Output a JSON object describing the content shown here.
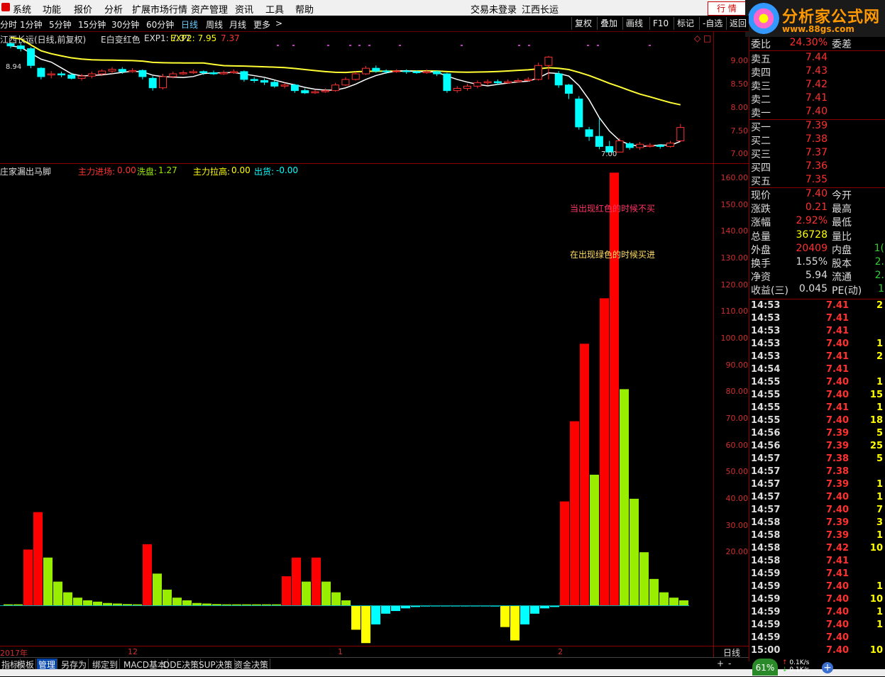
{
  "menubar": {
    "items": [
      "系统",
      "功能",
      "报价",
      "分析",
      "扩展市场行情",
      "资产管理",
      "资讯",
      "工具",
      "帮助"
    ],
    "trade_status": "交易未登录",
    "stock_name": "江西长运",
    "trade_button": "行  情"
  },
  "brand": {
    "title": "分析家公式网",
    "url": "www.88gs.com"
  },
  "timeframes": {
    "items": [
      "分时",
      "1分钟",
      "5分钟",
      "15分钟",
      "30分钟",
      "60分钟",
      "日线",
      "周线",
      "月线",
      "更多"
    ],
    "active": "日线",
    "more_arrow": ">"
  },
  "chart_toolbar": [
    "复权",
    "叠加",
    "画线",
    "F10",
    "标记",
    "-自选",
    "返回"
  ],
  "price_panel": {
    "title": "江西长运(日线,前复权)",
    "indicator_name": "E白变红色",
    "exp1_label": "EXP1: 7.37",
    "exp2_label": "EXP2: 7.95",
    "last_value": "7.37",
    "high_marker": "8.94",
    "low_marker": "7.00",
    "axis_ticks": [
      "9.00",
      "8.50",
      "8.00",
      "7.50",
      "7.00"
    ],
    "icons": [
      "diamond-icon",
      "square-icon"
    ]
  },
  "volume_panel": {
    "title": "庄家漏出马脚",
    "lbl_main_entry": "主力进场:",
    "val_main_entry": "0.00",
    "lbl_wash": "洗盘:",
    "val_wash": "1.27",
    "lbl_pull": "主力拉高:",
    "val_pull": "0.00",
    "lbl_out": "出货:",
    "val_out": "-0.00",
    "note_red": "当出现红色的时候不买",
    "note_green": "在出现绿色的时候买进",
    "axis_ticks": [
      "160.00",
      "150.00",
      "140.00",
      "130.00",
      "120.00",
      "110.00",
      "100.00",
      "90.00",
      "80.00",
      "70.00",
      "60.00",
      "50.00",
      "40.00",
      "30.00",
      "20.00"
    ]
  },
  "chart_data": {
    "type": "bar",
    "ylim": [
      -15,
      165
    ],
    "colors": {
      "main": "#ff0000",
      "wash": "#99ee00",
      "pull": "#ffff00",
      "out": "#00ffff"
    },
    "bars": [
      {
        "type": "wash",
        "value": 0.5
      },
      {
        "type": "wash",
        "value": 0.5
      },
      {
        "type": "main",
        "value": 21
      },
      {
        "type": "main",
        "value": 35
      },
      {
        "type": "wash",
        "value": 18
      },
      {
        "type": "wash",
        "value": 9
      },
      {
        "type": "wash",
        "value": 5
      },
      {
        "type": "wash",
        "value": 3
      },
      {
        "type": "wash",
        "value": 2
      },
      {
        "type": "wash",
        "value": 1.5
      },
      {
        "type": "wash",
        "value": 1
      },
      {
        "type": "wash",
        "value": 0.8
      },
      {
        "type": "wash",
        "value": 0.6
      },
      {
        "type": "wash",
        "value": 0.5
      },
      {
        "type": "main",
        "value": 23
      },
      {
        "type": "wash",
        "value": 12
      },
      {
        "type": "wash",
        "value": 6
      },
      {
        "type": "wash",
        "value": 3
      },
      {
        "type": "wash",
        "value": 2
      },
      {
        "type": "wash",
        "value": 1
      },
      {
        "type": "wash",
        "value": 0.8
      },
      {
        "type": "wash",
        "value": 0.6
      },
      {
        "type": "wash",
        "value": 0.5
      },
      {
        "type": "wash",
        "value": 0.5
      },
      {
        "type": "wash",
        "value": 0.5
      },
      {
        "type": "wash",
        "value": 0.5
      },
      {
        "type": "wash",
        "value": 0.5
      },
      {
        "type": "wash",
        "value": 0.5
      },
      {
        "type": "main",
        "value": 11
      },
      {
        "type": "main",
        "value": 18
      },
      {
        "type": "wash",
        "value": 9
      },
      {
        "type": "main",
        "value": 18
      },
      {
        "type": "wash",
        "value": 9
      },
      {
        "type": "wash",
        "value": 5
      },
      {
        "type": "wash",
        "value": 2
      },
      {
        "type": "pull",
        "value": -9
      },
      {
        "type": "pull",
        "value": -14
      },
      {
        "type": "out",
        "value": -7
      },
      {
        "type": "out",
        "value": -3
      },
      {
        "type": "out",
        "value": -2
      },
      {
        "type": "out",
        "value": -1
      },
      {
        "type": "out",
        "value": -0.5
      },
      {
        "type": "out",
        "value": -0.3
      },
      {
        "type": "out",
        "value": -0.2
      },
      {
        "type": "out",
        "value": -0.2
      },
      {
        "type": "out",
        "value": -0.2
      },
      {
        "type": "out",
        "value": -0.2
      },
      {
        "type": "out",
        "value": -0.2
      },
      {
        "type": "out",
        "value": -0.2
      },
      {
        "type": "out",
        "value": -0.3
      },
      {
        "type": "pull",
        "value": -8
      },
      {
        "type": "pull",
        "value": -13
      },
      {
        "type": "out",
        "value": -7
      },
      {
        "type": "out",
        "value": -3
      },
      {
        "type": "out",
        "value": -1
      },
      {
        "type": "out",
        "value": -0.5
      },
      {
        "type": "main",
        "value": 39
      },
      {
        "type": "main",
        "value": 69
      },
      {
        "type": "main",
        "value": 98
      },
      {
        "type": "wash",
        "value": 49
      },
      {
        "type": "main",
        "value": 115
      },
      {
        "type": "main",
        "value": 162
      },
      {
        "type": "wash",
        "value": 81
      },
      {
        "type": "wash",
        "value": 40
      },
      {
        "type": "wash",
        "value": 20
      },
      {
        "type": "wash",
        "value": 10
      },
      {
        "type": "wash",
        "value": 5
      },
      {
        "type": "wash",
        "value": 3
      },
      {
        "type": "wash",
        "value": 2
      }
    ]
  },
  "price_data": {
    "ylim": [
      6.8,
      9.15
    ],
    "candles": [
      [
        8.94,
        8.9,
        8.96,
        8.86
      ],
      [
        8.9,
        8.85,
        8.95,
        8.8
      ],
      [
        8.85,
        8.55,
        8.88,
        8.5
      ],
      [
        8.5,
        8.35,
        8.52,
        8.3
      ],
      [
        8.38,
        8.4,
        8.45,
        8.32
      ],
      [
        8.4,
        8.38,
        8.44,
        8.34
      ],
      [
        8.38,
        8.32,
        8.42,
        8.3
      ],
      [
        8.32,
        8.36,
        8.4,
        8.28
      ],
      [
        8.36,
        8.4,
        8.44,
        8.32
      ],
      [
        8.4,
        8.45,
        8.48,
        8.36
      ],
      [
        8.45,
        8.48,
        8.52,
        8.4
      ],
      [
        8.48,
        8.44,
        8.52,
        8.4
      ],
      [
        8.44,
        8.46,
        8.5,
        8.42
      ],
      [
        8.46,
        8.35,
        8.48,
        8.3
      ],
      [
        8.32,
        8.15,
        8.36,
        8.1
      ],
      [
        8.15,
        8.35,
        8.4,
        8.12
      ],
      [
        8.35,
        8.4,
        8.44,
        8.32
      ],
      [
        8.4,
        8.42,
        8.46,
        8.38
      ],
      [
        8.42,
        8.44,
        8.48,
        8.4
      ],
      [
        8.44,
        8.42,
        8.46,
        8.38
      ],
      [
        8.42,
        8.4,
        8.46,
        8.38
      ],
      [
        8.4,
        8.42,
        8.46,
        8.38
      ],
      [
        8.42,
        8.44,
        8.48,
        8.4
      ],
      [
        8.44,
        8.3,
        8.46,
        8.26
      ],
      [
        8.3,
        8.28,
        8.34,
        8.24
      ],
      [
        8.28,
        8.25,
        8.32,
        8.2
      ],
      [
        8.25,
        8.18,
        8.28,
        8.15
      ],
      [
        8.18,
        8.2,
        8.24,
        8.14
      ],
      [
        8.2,
        8.1,
        8.22,
        8.06
      ],
      [
        8.1,
        8.06,
        8.14,
        8.04
      ],
      [
        8.06,
        8.08,
        8.12,
        8.04
      ],
      [
        8.08,
        8.1,
        8.14,
        8.06
      ],
      [
        8.1,
        8.2,
        8.24,
        8.08
      ],
      [
        8.2,
        8.3,
        8.34,
        8.18
      ],
      [
        8.3,
        8.4,
        8.44,
        8.28
      ],
      [
        8.4,
        8.5,
        8.54,
        8.38
      ],
      [
        8.5,
        8.45,
        8.55,
        8.42
      ],
      [
        8.45,
        8.44,
        8.48,
        8.4
      ],
      [
        8.44,
        8.45,
        8.48,
        8.42
      ],
      [
        8.45,
        8.44,
        8.48,
        8.4
      ],
      [
        8.44,
        8.42,
        8.46,
        8.4
      ],
      [
        8.42,
        8.44,
        8.48,
        8.4
      ],
      [
        8.44,
        8.4,
        8.46,
        8.36
      ],
      [
        8.4,
        8.1,
        8.42,
        8.06
      ],
      [
        8.1,
        8.14,
        8.18,
        8.06
      ],
      [
        8.14,
        8.18,
        8.22,
        8.1
      ],
      [
        8.18,
        8.24,
        8.28,
        8.14
      ],
      [
        8.24,
        8.26,
        8.3,
        8.2
      ],
      [
        8.26,
        8.24,
        8.3,
        8.2
      ],
      [
        8.24,
        8.26,
        8.3,
        8.22
      ],
      [
        8.26,
        8.28,
        8.32,
        8.24
      ],
      [
        8.28,
        8.3,
        8.34,
        8.26
      ],
      [
        8.3,
        8.55,
        8.6,
        8.28
      ],
      [
        8.55,
        8.7,
        8.72,
        8.3
      ],
      [
        8.4,
        8.2,
        8.45,
        8.15
      ],
      [
        8.2,
        8.05,
        8.22,
        7.95
      ],
      [
        7.95,
        7.45,
        8.0,
        7.4
      ],
      [
        7.4,
        7.28,
        7.45,
        7.2
      ],
      [
        7.28,
        7.1,
        7.6,
        7.05
      ],
      [
        7.1,
        7.0,
        7.2,
        7.0
      ],
      [
        7.0,
        7.2,
        7.25,
        7.0
      ],
      [
        7.15,
        7.08,
        7.18,
        7.04
      ],
      [
        7.08,
        7.14,
        7.18,
        7.04
      ],
      [
        7.1,
        7.12,
        7.16,
        7.08
      ],
      [
        7.12,
        7.1,
        7.14,
        7.06
      ],
      [
        7.1,
        7.16,
        7.2,
        7.08
      ],
      [
        7.2,
        7.44,
        7.5,
        7.18
      ]
    ]
  },
  "quote": {
    "top_row": {
      "label": "委比",
      "value": "24.30%",
      "label2": "委差"
    },
    "asks": [
      {
        "label": "卖五",
        "price": "7.44"
      },
      {
        "label": "卖四",
        "price": "7.43"
      },
      {
        "label": "卖三",
        "price": "7.42"
      },
      {
        "label": "卖二",
        "price": "7.41"
      },
      {
        "label": "卖一",
        "price": "7.40"
      }
    ],
    "bids": [
      {
        "label": "买一",
        "price": "7.39"
      },
      {
        "label": "买二",
        "price": "7.38"
      },
      {
        "label": "买三",
        "price": "7.37"
      },
      {
        "label": "买四",
        "price": "7.36"
      },
      {
        "label": "买五",
        "price": "7.35"
      }
    ],
    "stats": [
      {
        "label": "现价",
        "value": "7.40",
        "vcolor": "#ff3030",
        "label2": "今开",
        "v2": ""
      },
      {
        "label": "涨跌",
        "value": "0.21",
        "vcolor": "#ff3030",
        "label2": "最高",
        "v2": ""
      },
      {
        "label": "涨幅",
        "value": "2.92%",
        "vcolor": "#ff3030",
        "label2": "最低",
        "v2": ""
      },
      {
        "label": "总量",
        "value": "36728",
        "vcolor": "#ffff00",
        "label2": "量比",
        "v2": ""
      },
      {
        "label": "外盘",
        "value": "20409",
        "vcolor": "#ff3030",
        "label2": "内盘",
        "v2": "1("
      },
      {
        "label": "换手",
        "value": "1.55%",
        "vcolor": "#dddddd",
        "label2": "股本",
        "v2": "2."
      },
      {
        "label": "净资",
        "value": "5.94",
        "vcolor": "#dddddd",
        "label2": "流通",
        "v2": "2."
      },
      {
        "label": "收益(三)",
        "value": "0.045",
        "vcolor": "#dddddd",
        "label2": "PE(动)",
        "v2": "1"
      }
    ],
    "ticks": [
      {
        "t": "14:53",
        "p": "7.41",
        "v": "2",
        "c": "#ff3030"
      },
      {
        "t": "14:53",
        "p": "7.41",
        "v": "",
        "c": "#ff3030"
      },
      {
        "t": "14:53",
        "p": "7.41",
        "v": "",
        "c": "#ff3030"
      },
      {
        "t": "14:53",
        "p": "7.40",
        "v": "1",
        "c": "#ff3030"
      },
      {
        "t": "14:53",
        "p": "7.41",
        "v": "2",
        "c": "#ff3030"
      },
      {
        "t": "14:54",
        "p": "7.41",
        "v": "",
        "c": "#ff3030"
      },
      {
        "t": "14:55",
        "p": "7.40",
        "v": "1",
        "c": "#ff3030"
      },
      {
        "t": "14:55",
        "p": "7.40",
        "v": "15",
        "c": "#ff3030"
      },
      {
        "t": "14:55",
        "p": "7.41",
        "v": "1",
        "c": "#ff3030"
      },
      {
        "t": "14:55",
        "p": "7.40",
        "v": "18",
        "c": "#ff3030"
      },
      {
        "t": "14:56",
        "p": "7.39",
        "v": "5",
        "c": "#ff3030"
      },
      {
        "t": "14:56",
        "p": "7.39",
        "v": "25",
        "c": "#ff3030"
      },
      {
        "t": "14:57",
        "p": "7.38",
        "v": "5",
        "c": "#ff3030"
      },
      {
        "t": "14:57",
        "p": "7.38",
        "v": "",
        "c": "#ff3030"
      },
      {
        "t": "14:57",
        "p": "7.39",
        "v": "1",
        "c": "#ff3030"
      },
      {
        "t": "14:57",
        "p": "7.40",
        "v": "1",
        "c": "#ff3030"
      },
      {
        "t": "14:57",
        "p": "7.40",
        "v": "7",
        "c": "#ff3030"
      },
      {
        "t": "14:58",
        "p": "7.39",
        "v": "3",
        "c": "#ff3030"
      },
      {
        "t": "14:58",
        "p": "7.39",
        "v": "1",
        "c": "#ff3030"
      },
      {
        "t": "14:58",
        "p": "7.42",
        "v": "10",
        "c": "#ff3030"
      },
      {
        "t": "14:58",
        "p": "7.41",
        "v": "",
        "c": "#ff3030"
      },
      {
        "t": "14:59",
        "p": "7.41",
        "v": "",
        "c": "#ff3030"
      },
      {
        "t": "14:59",
        "p": "7.40",
        "v": "1",
        "c": "#ff3030"
      },
      {
        "t": "14:59",
        "p": "7.40",
        "v": "10",
        "c": "#ff3030"
      },
      {
        "t": "14:59",
        "p": "7.40",
        "v": "1",
        "c": "#ff3030"
      },
      {
        "t": "14:59",
        "p": "7.40",
        "v": "1",
        "c": "#ff3030"
      },
      {
        "t": "14:59",
        "p": "7.40",
        "v": "",
        "c": "#ff3030"
      },
      {
        "t": "15:00",
        "p": "7.40",
        "v": "10",
        "c": "#ff3030"
      }
    ]
  },
  "datebar": {
    "labels": [
      "2017年",
      "12",
      "1",
      "2"
    ],
    "period_label": "日线"
  },
  "bottom_tabs": [
    "指标",
    "模板",
    "管理",
    "另存为",
    "绑定到",
    "MACD基本",
    "DDE决策",
    "SUP决策",
    "资金决策"
  ],
  "bottom_tabs_active": "管理",
  "status": {
    "gauge": "61%",
    "up_speed": "0.1K/s",
    "down_speed": "0.1K/s"
  }
}
